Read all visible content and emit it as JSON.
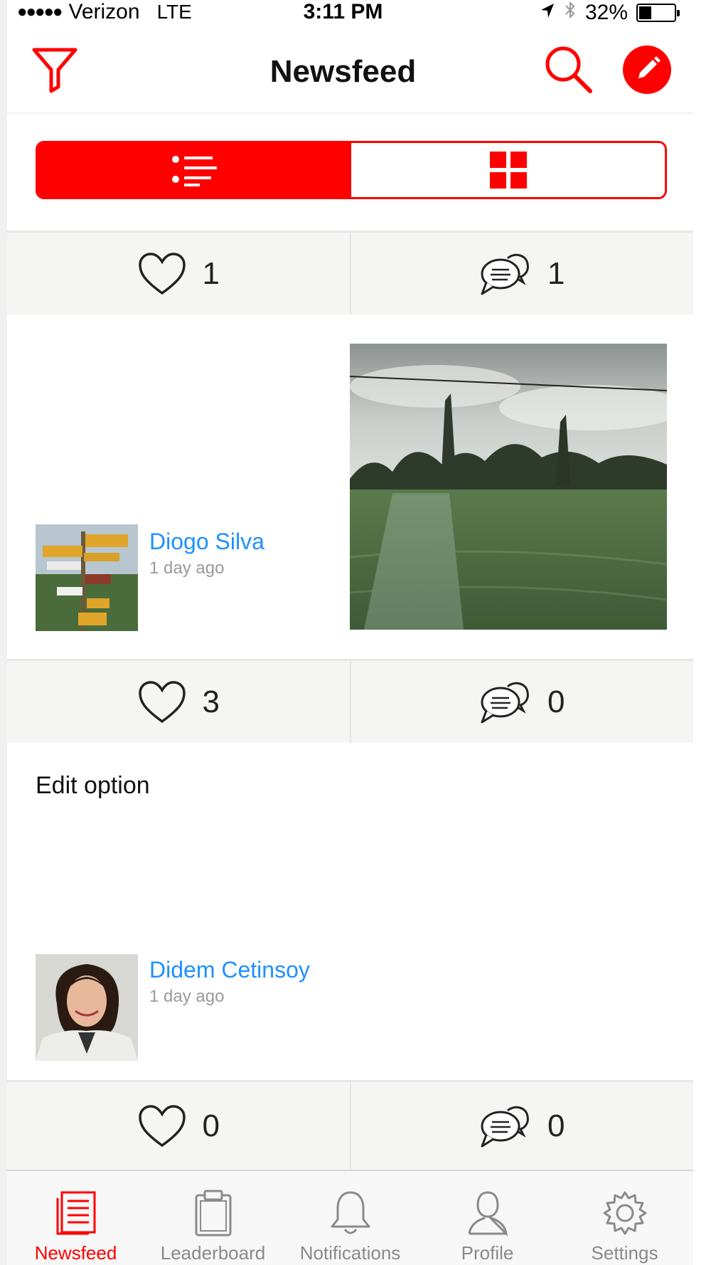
{
  "status_bar": {
    "signal": "●●●●●",
    "carrier": "Verizon",
    "network": "LTE",
    "time": "3:11 PM",
    "battery": "32%",
    "battery_level": 0.32
  },
  "nav": {
    "title": "Newsfeed",
    "filter_icon": "filter-icon",
    "search_icon": "search-icon",
    "compose_icon": "pencil-icon"
  },
  "view_toggle": {
    "options": [
      "list",
      "grid"
    ],
    "selected": "list"
  },
  "actionbars": [
    {
      "likes": "1",
      "comments": "1"
    },
    {
      "likes": "3",
      "comments": "0"
    },
    {
      "likes": "0",
      "comments": "0"
    }
  ],
  "posts": [
    {
      "author": "Diogo Silva",
      "time": "1 day ago",
      "has_photo": true
    },
    {
      "author": "Didem Cetinsoy",
      "time": "1 day ago",
      "text": "Edit option"
    }
  ],
  "tabs": [
    {
      "label": "Newsfeed",
      "icon": "newsfeed-icon",
      "active": true
    },
    {
      "label": "Leaderboard",
      "icon": "clipboard-icon",
      "active": false
    },
    {
      "label": "Notifications",
      "icon": "bell-icon",
      "active": false
    },
    {
      "label": "Profile",
      "icon": "person-icon",
      "active": false
    },
    {
      "label": "Settings",
      "icon": "gear-icon",
      "active": false
    }
  ],
  "colors": {
    "accent": "#ff0000",
    "link": "#1e90ff",
    "bar_bg": "#f5f5f3"
  }
}
